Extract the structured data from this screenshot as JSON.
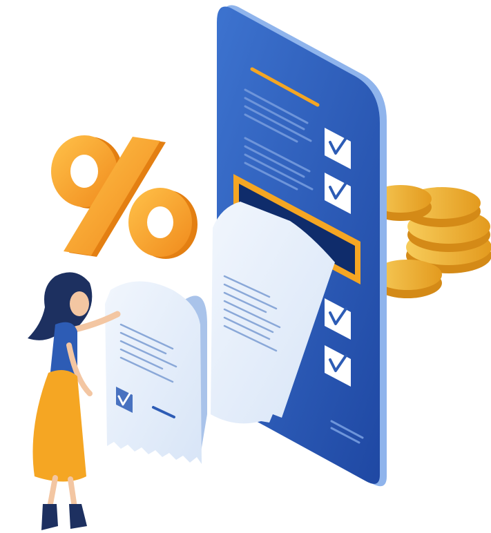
{
  "illustration": {
    "percent_symbol": "%",
    "checklist": [
      {
        "checked": true
      },
      {
        "checked": true
      },
      {
        "checked": true
      },
      {
        "checked": true
      }
    ],
    "receipt_checkbox": {
      "checked": true
    }
  },
  "colors": {
    "phone_blue": "#2e5fb8",
    "phone_dark": "#1d3f8c",
    "phone_edge": "#8fb4ec",
    "accent_orange": "#f5a623",
    "coin_gold": "#f2b632",
    "paper": "#e8f0fb",
    "paper_shadow": "#c9d9f1",
    "check_blue": "#2d5cb5"
  },
  "icons": [
    "percent-icon",
    "checkmark-icon",
    "coin-icon"
  ]
}
